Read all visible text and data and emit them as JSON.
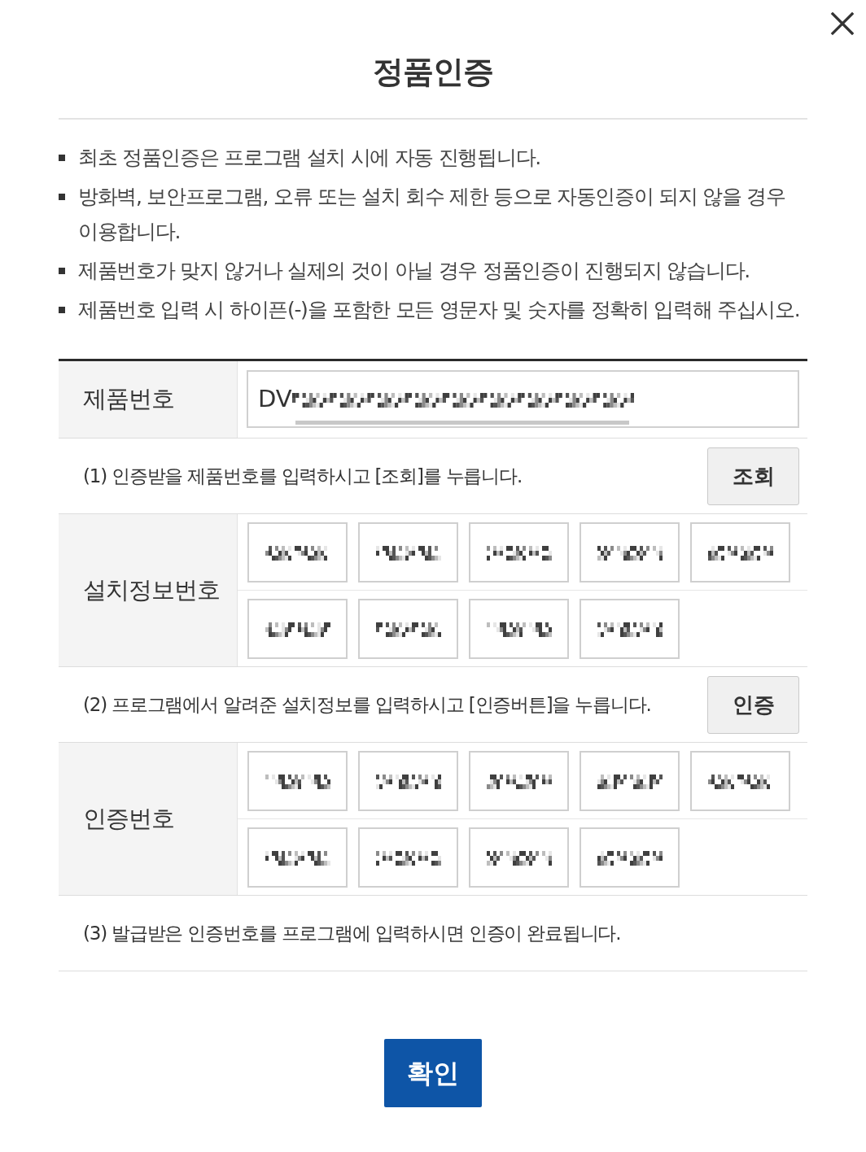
{
  "dialog": {
    "title": "정품인증"
  },
  "notes": [
    "최초 정품인증은 프로그램 설치 시에 자동 진행됩니다.",
    "방화벽, 보안프로그램, 오류 또는 설치 회수 제한 등으로 자동인증이 되지 않을 경우 이용합니다.",
    "제품번호가 맞지 않거나 실제의 것이 아닐 경우 정품인증이 진행되지 않습니다.",
    "제품번호 입력 시 하이픈(-)을 포함한 모든 영문자 및 숫자를 정확히 입력해 주십시오."
  ],
  "form": {
    "rows": [
      {
        "kind": "product",
        "label": "제품번호",
        "value": "DV",
        "obscured": true
      },
      {
        "kind": "step",
        "text": "(1) 인증받을 제품번호를 입력하시고 [조회]를 누릅니다.",
        "button": "조회"
      },
      {
        "kind": "codes",
        "label": "설치정보번호",
        "fields": [
          {
            "obscured": true
          },
          {
            "obscured": true
          },
          {
            "obscured": true
          },
          {
            "obscured": true
          },
          {
            "obscured": true
          },
          {
            "obscured": true
          },
          {
            "obscured": true
          },
          {
            "obscured": true
          },
          {
            "obscured": true
          }
        ]
      },
      {
        "kind": "step",
        "text": "(2) 프로그램에서 알려준 설치정보를 입력하시고 [인증버튼]을 누릅니다.",
        "button": "인증"
      },
      {
        "kind": "codes",
        "label": "인증번호",
        "fields": [
          {
            "obscured": true
          },
          {
            "obscured": true
          },
          {
            "obscured": true
          },
          {
            "obscured": true
          },
          {
            "obscured": true
          },
          {
            "obscured": true
          },
          {
            "obscured": true
          },
          {
            "obscured": true
          },
          {
            "obscured": true
          }
        ]
      },
      {
        "kind": "step",
        "text": "(3) 발급받은 인증번호를 프로그램에 입력하시면 인증이 완료됩니다."
      }
    ]
  },
  "confirm_button": "확인"
}
